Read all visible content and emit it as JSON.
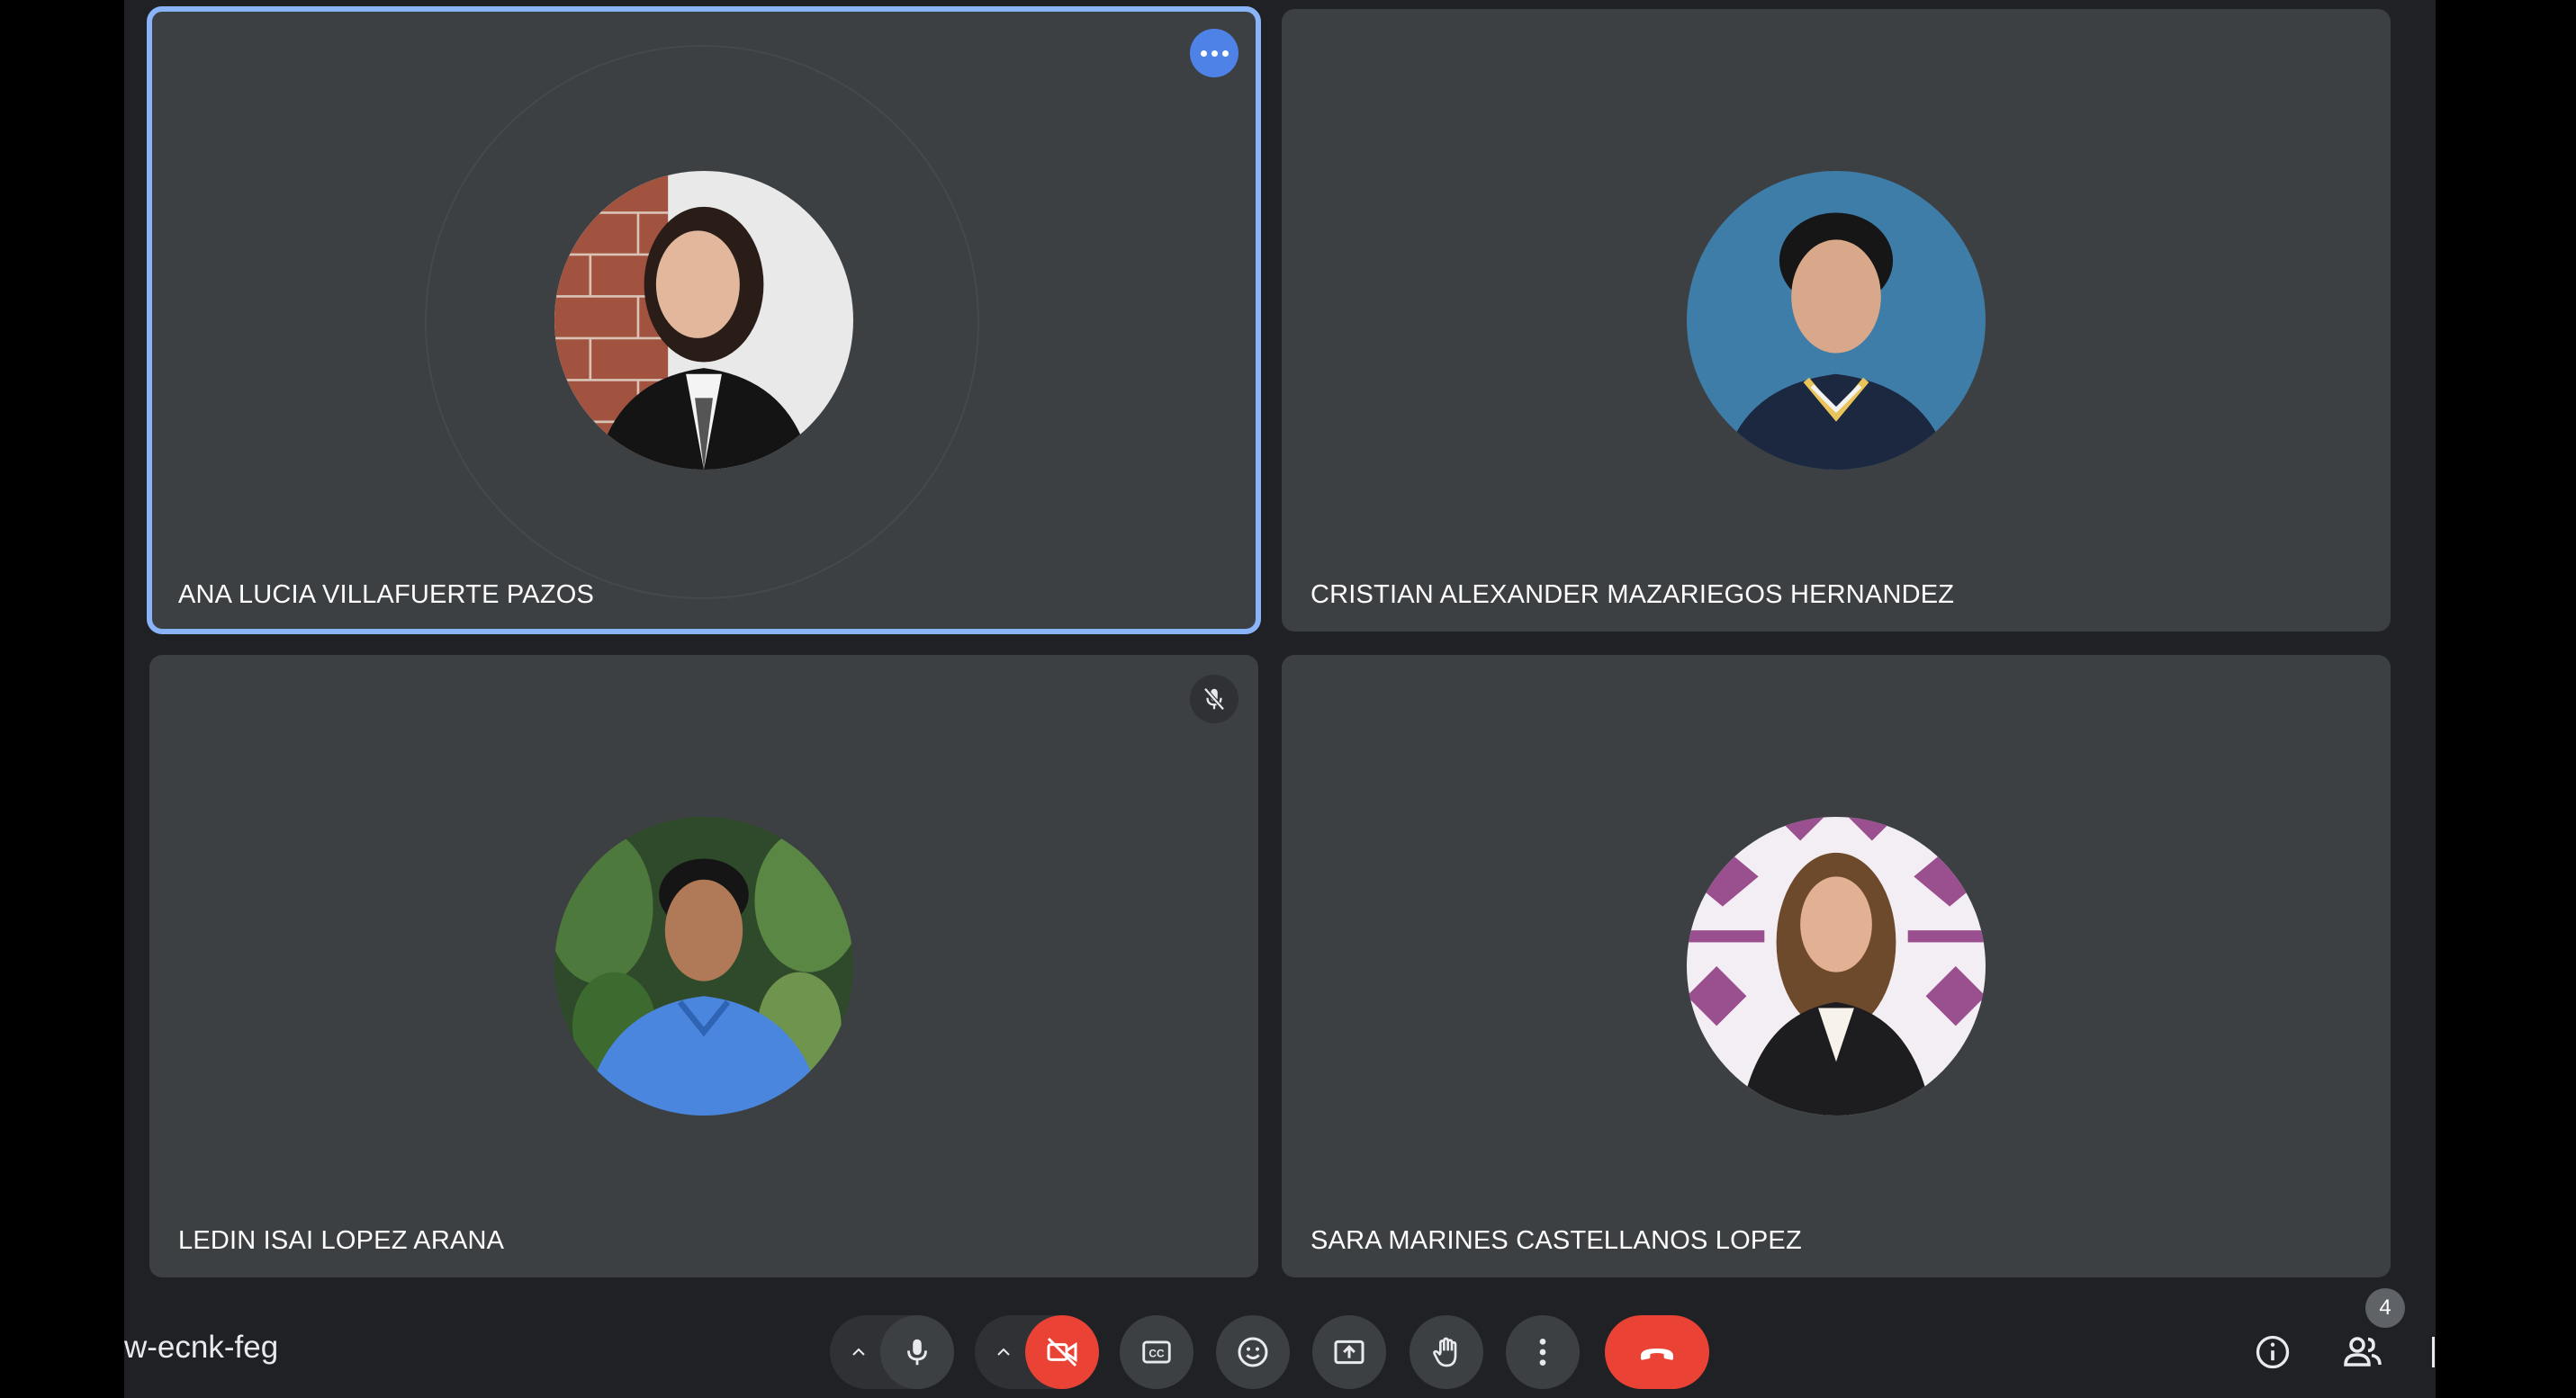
{
  "meeting": {
    "code": "w-ecnk-feg",
    "participant_count": "4"
  },
  "participants": [
    {
      "name": "ANA LUCIA VILLAFUERTE PAZOS",
      "active_speaker": true,
      "muted": false
    },
    {
      "name": "CRISTIAN ALEXANDER MAZARIEGOS HERNANDEZ",
      "active_speaker": false,
      "muted": false
    },
    {
      "name": "LEDIN ISAI LOPEZ ARANA",
      "active_speaker": false,
      "muted": true
    },
    {
      "name": "SARA MARINES CASTELLANOS LOPEZ",
      "active_speaker": false,
      "muted": false
    }
  ],
  "colors": {
    "background": "#202124",
    "tile": "#3c4043",
    "active_border": "#8ab4f8",
    "danger": "#ea4335",
    "menu_blue": "#4f82e7"
  },
  "icons": {
    "tile_menu": "more-horizontal-icon",
    "muted": "mic-off-icon",
    "mic": "mic-icon",
    "camera_off": "videocam-off-icon",
    "captions": "closed-captions-icon",
    "emoji": "emoji-icon",
    "present": "present-screen-icon",
    "raise_hand": "hand-icon",
    "more": "more-vertical-icon",
    "leave": "call-end-icon",
    "info": "info-icon",
    "people": "people-icon"
  }
}
